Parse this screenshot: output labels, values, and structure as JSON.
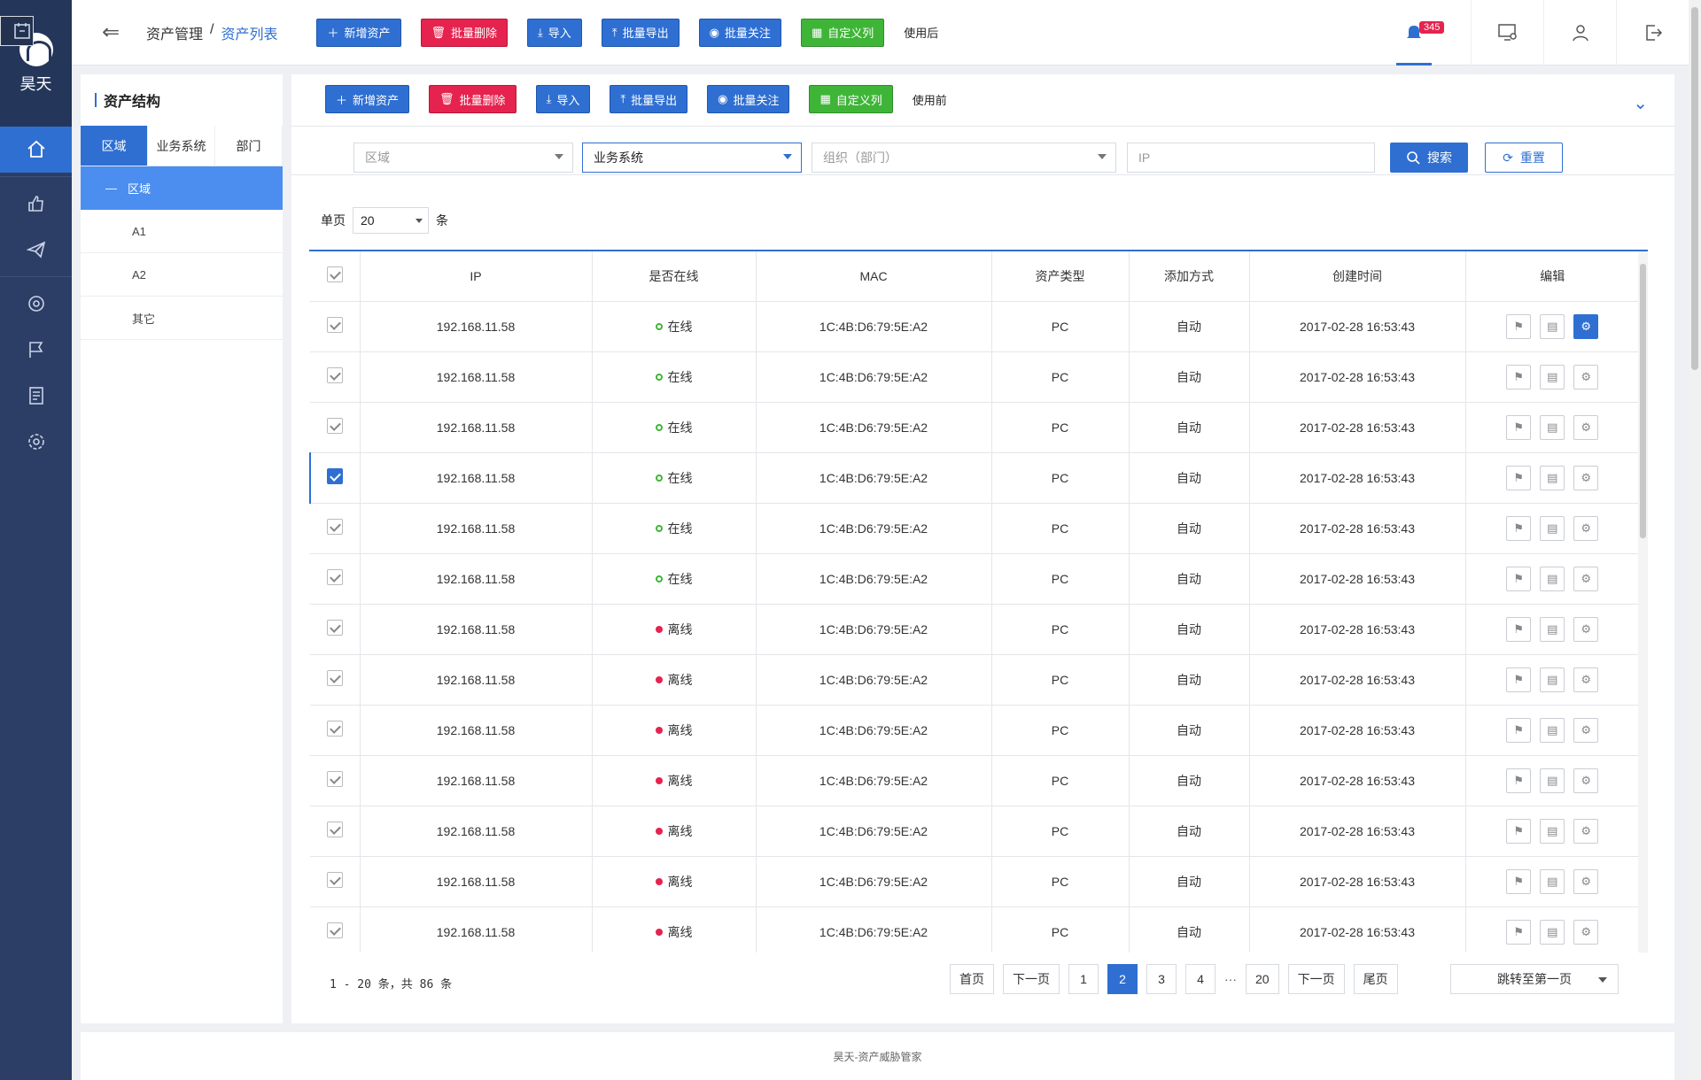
{
  "app": {
    "logo_text": "昊天",
    "footer": "昊天-资产威胁管家",
    "accent": "#2f6fd2"
  },
  "nav": {
    "items": [
      "home-icon",
      "thumb-icon",
      "calendar-icon",
      "send-icon",
      "scan-icon",
      "flag-icon",
      "report-icon",
      "gear-icon"
    ]
  },
  "topbar": {
    "breadcrumb_parent": "资产管理",
    "breadcrumb_sep": "/",
    "breadcrumb_current": "资产列表",
    "buttons": [
      "新增资产",
      "批量删除",
      "导入",
      "批量导出",
      "批量关注",
      "自定义列"
    ],
    "after_label": "使用后",
    "badge": "345"
  },
  "tree": {
    "title": "资产结构",
    "tabs": [
      "区域",
      "业务系统",
      "部门"
    ],
    "root": "区域",
    "items": [
      "A1",
      "A2",
      "其它"
    ]
  },
  "main": {
    "buttons": [
      "新增资产",
      "批量删除",
      "导入",
      "批量导出",
      "批量关注",
      "自定义列"
    ],
    "before_label": "使用前"
  },
  "filters": {
    "region_placeholder": "区域",
    "business_value": "业务系统",
    "org_placeholder": "组织（部门）",
    "ip_placeholder": "IP",
    "search": "搜索",
    "reset": "重置"
  },
  "pagesize": {
    "label_before": "单页",
    "value": "20",
    "label_after": "条"
  },
  "table": {
    "columns": [
      "IP",
      "是否在线",
      "MAC",
      "资产类型",
      "添加方式",
      "创建时间",
      "编辑"
    ],
    "rows": [
      {
        "ip": "192.168.11.58",
        "status": "在线",
        "online": true,
        "mac": "1C:4B:D6:79:5E:A2",
        "type": "PC",
        "method": "自动",
        "created": "2017-02-28 16:53:43"
      },
      {
        "ip": "192.168.11.58",
        "status": "在线",
        "online": true,
        "mac": "1C:4B:D6:79:5E:A2",
        "type": "PC",
        "method": "自动",
        "created": "2017-02-28 16:53:43"
      },
      {
        "ip": "192.168.11.58",
        "status": "在线",
        "online": true,
        "mac": "1C:4B:D6:79:5E:A2",
        "type": "PC",
        "method": "自动",
        "created": "2017-02-28 16:53:43"
      },
      {
        "ip": "192.168.11.58",
        "status": "在线",
        "online": true,
        "mac": "1C:4B:D6:79:5E:A2",
        "type": "PC",
        "method": "自动",
        "created": "2017-02-28 16:53:43"
      },
      {
        "ip": "192.168.11.58",
        "status": "在线",
        "online": true,
        "mac": "1C:4B:D6:79:5E:A2",
        "type": "PC",
        "method": "自动",
        "created": "2017-02-28 16:53:43"
      },
      {
        "ip": "192.168.11.58",
        "status": "在线",
        "online": true,
        "mac": "1C:4B:D6:79:5E:A2",
        "type": "PC",
        "method": "自动",
        "created": "2017-02-28 16:53:43"
      },
      {
        "ip": "192.168.11.58",
        "status": "离线",
        "online": false,
        "mac": "1C:4B:D6:79:5E:A2",
        "type": "PC",
        "method": "自动",
        "created": "2017-02-28 16:53:43"
      },
      {
        "ip": "192.168.11.58",
        "status": "离线",
        "online": false,
        "mac": "1C:4B:D6:79:5E:A2",
        "type": "PC",
        "method": "自动",
        "created": "2017-02-28 16:53:43"
      },
      {
        "ip": "192.168.11.58",
        "status": "离线",
        "online": false,
        "mac": "1C:4B:D6:79:5E:A2",
        "type": "PC",
        "method": "自动",
        "created": "2017-02-28 16:53:43"
      },
      {
        "ip": "192.168.11.58",
        "status": "离线",
        "online": false,
        "mac": "1C:4B:D6:79:5E:A2",
        "type": "PC",
        "method": "自动",
        "created": "2017-02-28 16:53:43"
      },
      {
        "ip": "192.168.11.58",
        "status": "离线",
        "online": false,
        "mac": "1C:4B:D6:79:5E:A2",
        "type": "PC",
        "method": "自动",
        "created": "2017-02-28 16:53:43"
      },
      {
        "ip": "192.168.11.58",
        "status": "离线",
        "online": false,
        "mac": "1C:4B:D6:79:5E:A2",
        "type": "PC",
        "method": "自动",
        "created": "2017-02-28 16:53:43"
      },
      {
        "ip": "192.168.11.58",
        "status": "离线",
        "online": false,
        "mac": "1C:4B:D6:79:5E:A2",
        "type": "PC",
        "method": "自动",
        "created": "2017-02-28 16:53:43"
      }
    ],
    "checked_highlight_row": 3
  },
  "pager": {
    "info": "1 - 20 条，共 86 条",
    "first": "首页",
    "prev": "下一页",
    "pages": [
      "1",
      "2",
      "3",
      "4"
    ],
    "current": "2",
    "ellipsis": "···",
    "last_page": "20",
    "next": "下一页",
    "last": "尾页",
    "jump": "跳转至第一页"
  }
}
